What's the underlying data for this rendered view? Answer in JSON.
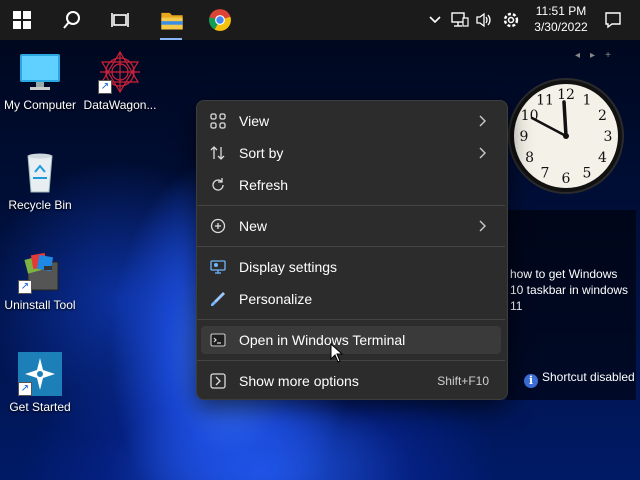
{
  "taskbar": {
    "start_icon": "windows-logo-icon",
    "search_icon": "search-icon",
    "task_view_icon": "task-view-icon",
    "pinned": [
      {
        "name": "file-explorer-icon"
      },
      {
        "name": "chrome-icon"
      }
    ],
    "tray": [
      "chevron-up-icon",
      "network-icon",
      "volume-icon",
      "settings-icon"
    ],
    "time": "11:51 PM",
    "date": "3/30/2022",
    "notification_icon": "notification-icon"
  },
  "desktop_icons": [
    {
      "label": "My Computer",
      "icon": "monitor-icon"
    },
    {
      "label": "DataWagon...",
      "icon": "datawagon-icon"
    },
    {
      "label": "Recycle Bin",
      "icon": "recycle-bin-icon"
    },
    {
      "label": "Uninstall Tool",
      "icon": "uninstall-tool-icon"
    },
    {
      "label": "Get Started",
      "icon": "get-started-icon"
    }
  ],
  "gadgets": {
    "nav_prev": "◂",
    "nav_next": "▸",
    "nav_add": "+",
    "clock_numerals": [
      "12",
      "1",
      "2",
      "3",
      "4",
      "5",
      "6",
      "7",
      "8",
      "9",
      "10",
      "11"
    ],
    "news_text": "how to get Windows 10 taskbar in windows 11",
    "shortcut_note": "Shortcut disabled",
    "info_glyph": "i"
  },
  "context_menu": {
    "items": [
      {
        "label": "View",
        "icon": "view-grid-icon",
        "submenu": true
      },
      {
        "label": "Sort by",
        "icon": "sort-icon",
        "submenu": true
      },
      {
        "label": "Refresh",
        "icon": "refresh-icon",
        "submenu": false
      },
      {
        "label": "New",
        "icon": "new-plus-icon",
        "submenu": true
      },
      {
        "label": "Display settings",
        "icon": "display-settings-icon",
        "submenu": false
      },
      {
        "label": "Personalize",
        "icon": "personalize-brush-icon",
        "submenu": false
      },
      {
        "label": "Open in Windows Terminal",
        "icon": "terminal-icon",
        "submenu": false,
        "hovered": true
      },
      {
        "label": "Show more options",
        "icon": "show-more-options-icon",
        "submenu": false,
        "shortcut": "Shift+F10"
      }
    ]
  },
  "colors": {
    "taskbar": "#1b1b1b",
    "menu_bg": "#2c2c2c",
    "accent": "#3b6fd6"
  }
}
